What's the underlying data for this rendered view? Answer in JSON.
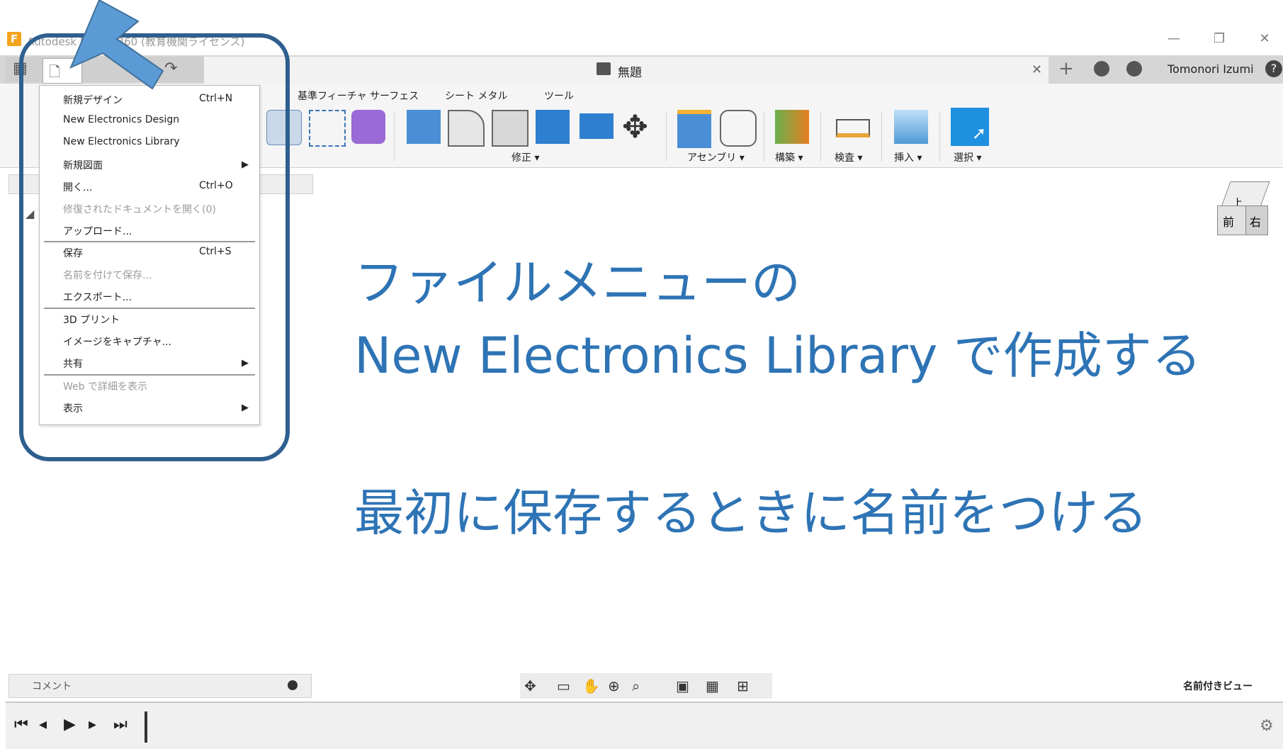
{
  "window": {
    "app_title": "Autodesk Fusion 360 (教育機関ライセンス)",
    "logo_letter": "F",
    "minimize": "—",
    "restore": "❐",
    "close": "✕"
  },
  "tabbar": {
    "doc_title": "無題",
    "close_tab": "✕",
    "new_tab": "+",
    "user_name": "Tomonori Izumi",
    "help": "?"
  },
  "ribbon": {
    "tabs": [
      "基準フィーチャ サーフェス",
      "シート メタル",
      "ツール"
    ],
    "groups": [
      "修正 ▾",
      "アセンブリ ▾",
      "構築 ▾",
      "検査 ▾",
      "挿入 ▾",
      "選択 ▾"
    ]
  },
  "file_menu": {
    "items": [
      {
        "label": "新規デザイン",
        "shortcut": "Ctrl+N"
      },
      {
        "label": "New Electronics Design"
      },
      {
        "label": "New Electronics Library"
      },
      {
        "label": "新規図面",
        "submenu": "▶"
      },
      {
        "label": "開く...",
        "shortcut": "Ctrl+O"
      },
      {
        "label": "修復されたドキュメントを開く(0)"
      },
      {
        "label": "アップロード..."
      },
      {
        "label": "保存",
        "shortcut": "Ctrl+S"
      },
      {
        "label": "名前を付けて保存..."
      },
      {
        "label": "エクスポート..."
      },
      {
        "label": "3D プリント"
      },
      {
        "label": "イメージをキャプチャ..."
      },
      {
        "label": "共有",
        "submenu": "▶"
      },
      {
        "label": "Web で詳細を表示"
      },
      {
        "label": "表示",
        "submenu": "▶"
      }
    ]
  },
  "annotation": {
    "line1": "ファイルメニューの",
    "line2": "New Electronics Library で作成する",
    "line3": "最初に保存するときに名前をつける",
    "color": "#2e74b5"
  },
  "bottom": {
    "comment_label": "コメント",
    "named_views": "名前付きビュー"
  },
  "viewcube": {
    "top": "上",
    "front": "前",
    "right": "右"
  }
}
